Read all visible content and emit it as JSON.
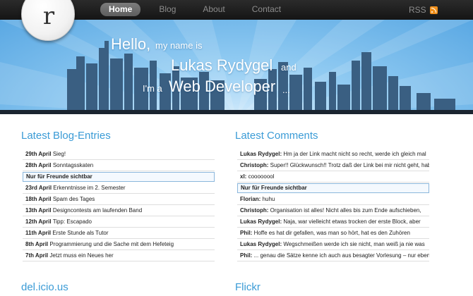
{
  "nav": {
    "items": [
      {
        "label": "Home",
        "active": true
      },
      {
        "label": "Blog",
        "active": false
      },
      {
        "label": "About",
        "active": false
      },
      {
        "label": "Contact",
        "active": false
      }
    ],
    "rss_label": "RSS"
  },
  "logo": {
    "letter": "r"
  },
  "hero": {
    "line1_big": "Hello,",
    "line1_small": "my name is",
    "line2_big": "Lukas Rydygel",
    "line2_small": "and",
    "line3_small": "I'm a",
    "line3_big": "Web Developer",
    "line3_end": "..."
  },
  "colors": {
    "accent": "#3a9bd6",
    "topbar": "#1f1f1f",
    "sky": "#5aa8e3",
    "city": "#3a5f82"
  },
  "blog": {
    "title": "Latest Blog-Entries",
    "entries": [
      {
        "date": "29th April",
        "text": "Sieg!"
      },
      {
        "date": "28th April",
        "text": "Sonntagsskaten"
      },
      {
        "date": "",
        "text": "Nur für Freunde sichtbar",
        "highlight": true
      },
      {
        "date": "23rd April",
        "text": "Erkenntnisse im 2. Semester"
      },
      {
        "date": "18th April",
        "text": "Spam des Tages"
      },
      {
        "date": "13th April",
        "text": "Designcontests am laufenden Band"
      },
      {
        "date": "12th April",
        "text": "Tipp: Escapado"
      },
      {
        "date": "11th April",
        "text": "Erste Stunde als Tutor"
      },
      {
        "date": "8th April",
        "text": "Programmierung und die Sache mit dem Hefeteig"
      },
      {
        "date": "7th April",
        "text": "Jetzt muss ein Neues her"
      }
    ]
  },
  "comments": {
    "title": "Latest Comments",
    "entries": [
      {
        "author": "Lukas Rydygel:",
        "text": "Hm ja der Link macht nicht so recht, werde ich gleich mal"
      },
      {
        "author": "Christoph:",
        "text": "Super!! Glückwunsch!! Trotz daß der Link bei mir nicht geht, hab"
      },
      {
        "author": "xl:",
        "text": "coooooool"
      },
      {
        "author": "",
        "text": "Nur für Freunde sichtbar",
        "highlight": true
      },
      {
        "author": "Florian:",
        "text": "huhu"
      },
      {
        "author": "Christoph:",
        "text": "Organisation ist alles! Nicht alles bis zum Ende aufschieben,"
      },
      {
        "author": "Lukas Rydygel:",
        "text": "Naja, war vielleicht etwas trocken der erste Block, aber"
      },
      {
        "author": "Phil:",
        "text": "Hoffe es hat dir gefallen, was man so hört, hat es den Zuhören"
      },
      {
        "author": "Lukas Rydygel:",
        "text": "Wegschmeißen werde ich sie nicht, man weiß ja nie was"
      },
      {
        "author": "Phil:",
        "text": "... genau die Sätze kenne ich auch aus besagter Vorlesung – nur eben"
      }
    ]
  },
  "bottom": {
    "delicious_title": "del.icio.us",
    "flickr_title": "Flickr"
  }
}
